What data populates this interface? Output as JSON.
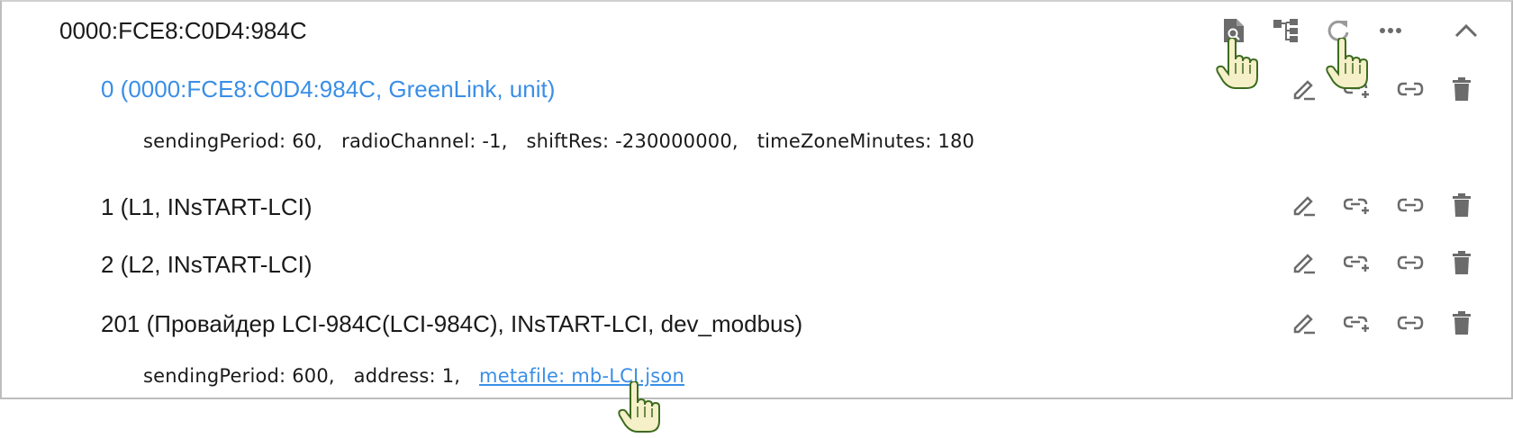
{
  "device": {
    "id": "0000:FCE8:C0D4:984C",
    "toolbar": {
      "view_icon": "file-search-icon",
      "tree_icon": "tree-structure-icon",
      "refresh_icon": "refresh-icon",
      "more_icon": "more-horizontal-icon",
      "collapse_icon": "chevron-up-icon"
    }
  },
  "units": [
    {
      "title": "0 (0000:FCE8:C0D4:984C, GreenLink, unit)",
      "is_link": true,
      "params": [
        "sendingPeriod: 60,",
        "radioChannel: -1,",
        "shiftRes: -230000000,",
        "timeZoneMinutes: 180"
      ]
    },
    {
      "title": "1 (L1, INsTART-LCI)",
      "is_link": false,
      "params": []
    },
    {
      "title": "2 (L2, INsTART-LCI)",
      "is_link": false,
      "params": []
    },
    {
      "title": "201 (Провайдер LCI-984C(LCI-984C), INsTART-LCI, dev_modbus)",
      "is_link": false,
      "params": [
        "sendingPeriod: 600,",
        "address: 1,"
      ],
      "metafile_link": "metafile: mb-LCI.json"
    }
  ],
  "row_actions": {
    "edit_icon": "edit-icon",
    "add_link_icon": "add-link-icon",
    "link_icon": "link-icon",
    "delete_icon": "trash-icon"
  },
  "colors": {
    "link": "#3a8ee6",
    "icon": "#6b6b6b",
    "border": "#bdbdbd",
    "cursor_fill": "#f5f0c8"
  }
}
